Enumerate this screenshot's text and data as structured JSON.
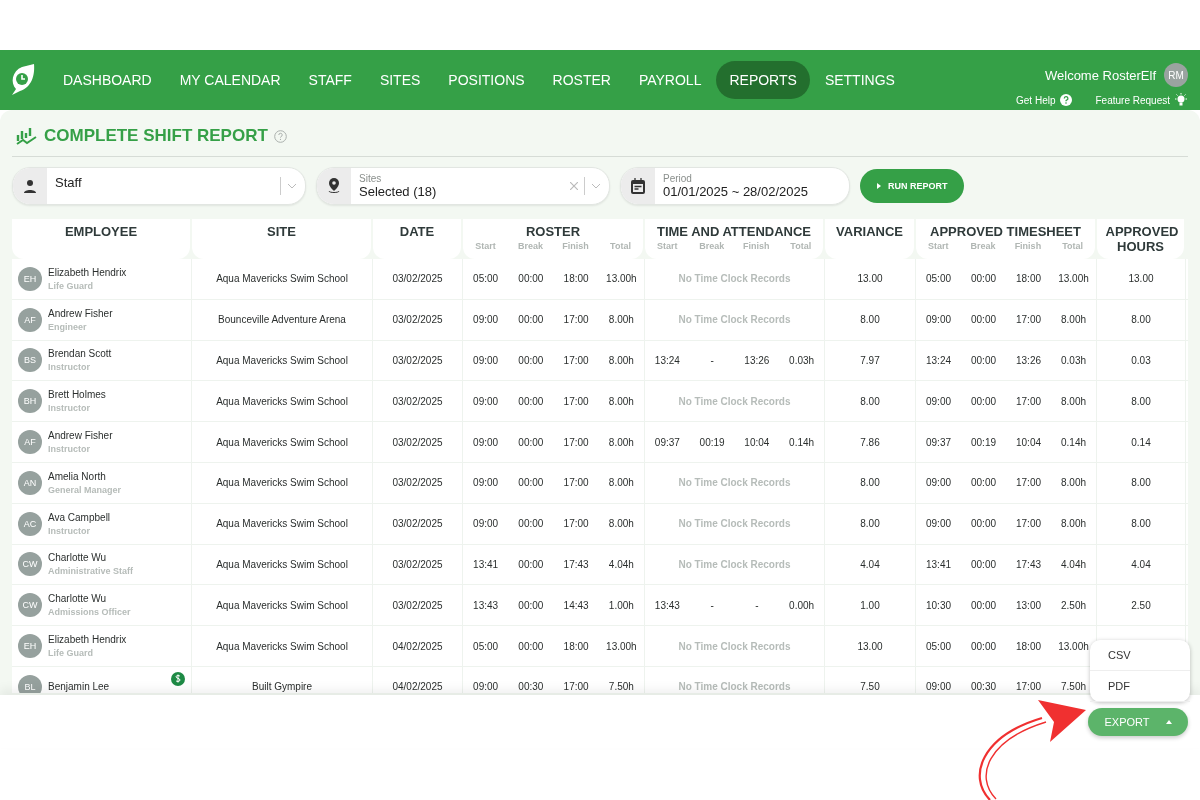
{
  "nav": {
    "items": [
      {
        "label": "DASHBOARD",
        "selected": false
      },
      {
        "label": "MY CALENDAR",
        "selected": false
      },
      {
        "label": "STAFF",
        "selected": false
      },
      {
        "label": "SITES",
        "selected": false
      },
      {
        "label": "POSITIONS",
        "selected": false
      },
      {
        "label": "ROSTER",
        "selected": false
      },
      {
        "label": "PAYROLL",
        "selected": false
      },
      {
        "label": "REPORTS",
        "selected": true
      },
      {
        "label": "SETTINGS",
        "selected": false
      }
    ],
    "welcome": "Welcome RosterElf",
    "avatar": "RM",
    "help": "Get Help",
    "feature": "Feature Request"
  },
  "page_title": "COMPLETE SHIFT REPORT",
  "filters": {
    "staff": {
      "value": "Staff"
    },
    "sites": {
      "label": "Sites",
      "value": "Selected (18)"
    },
    "period": {
      "label": "Period",
      "value": "01/01/2025 ~ 28/02/2025"
    },
    "run": "RUN REPORT"
  },
  "table": {
    "columns": [
      {
        "title": "EMPLOYEE"
      },
      {
        "title": "SITE"
      },
      {
        "title": "DATE"
      },
      {
        "title": "ROSTER",
        "sub": [
          "Start",
          "Break",
          "Finish",
          "Total"
        ]
      },
      {
        "title": "TIME AND ATTENDANCE",
        "sub": [
          "Start",
          "Break",
          "Finish",
          "Total"
        ]
      },
      {
        "title": "VARIANCE"
      },
      {
        "title": "APPROVED TIMESHEET",
        "sub": [
          "Start",
          "Break",
          "Finish",
          "Total"
        ]
      },
      {
        "title": "APPROVED HOURS"
      }
    ],
    "rows": [
      {
        "initials": "EH",
        "name": "Elizabeth Hendrix",
        "role": "Life Guard",
        "site": "Aqua Mavericks Swim School",
        "date": "03/02/2025",
        "roster": [
          "05:00",
          "00:00",
          "18:00",
          "13.00h"
        ],
        "attendance": {
          "kind": "empty",
          "text": "No Time Clock Records"
        },
        "variance": "13.00",
        "approved": [
          "05:00",
          "00:00",
          "18:00",
          "13.00h"
        ],
        "approved_hours": "13.00"
      },
      {
        "initials": "AF",
        "name": "Andrew Fisher",
        "role": "Engineer",
        "site": "Bounceville Adventure Arena",
        "date": "03/02/2025",
        "roster": [
          "09:00",
          "00:00",
          "17:00",
          "8.00h"
        ],
        "attendance": {
          "kind": "empty",
          "text": "No Time Clock Records"
        },
        "variance": "8.00",
        "approved": [
          "09:00",
          "00:00",
          "17:00",
          "8.00h"
        ],
        "approved_hours": "8.00"
      },
      {
        "initials": "BS",
        "name": "Brendan Scott",
        "role": "Instructor",
        "site": "Aqua Mavericks Swim School",
        "date": "03/02/2025",
        "roster": [
          "09:00",
          "00:00",
          "17:00",
          "8.00h"
        ],
        "attendance": {
          "kind": "times",
          "values": [
            "13:24",
            "-",
            "13:26",
            "0.03h"
          ]
        },
        "variance": "7.97",
        "approved": [
          "13:24",
          "00:00",
          "13:26",
          "0.03h"
        ],
        "approved_hours": "0.03"
      },
      {
        "initials": "BH",
        "name": "Brett Holmes",
        "role": "Instructor",
        "site": "Aqua Mavericks Swim School",
        "date": "03/02/2025",
        "roster": [
          "09:00",
          "00:00",
          "17:00",
          "8.00h"
        ],
        "attendance": {
          "kind": "empty",
          "text": "No Time Clock Records"
        },
        "variance": "8.00",
        "approved": [
          "09:00",
          "00:00",
          "17:00",
          "8.00h"
        ],
        "approved_hours": "8.00"
      },
      {
        "initials": "AF",
        "name": "Andrew Fisher",
        "role": "Instructor",
        "site": "Aqua Mavericks Swim School",
        "date": "03/02/2025",
        "roster": [
          "09:00",
          "00:00",
          "17:00",
          "8.00h"
        ],
        "attendance": {
          "kind": "times",
          "values": [
            "09:37",
            "00:19",
            "10:04",
            "0.14h"
          ]
        },
        "variance": "7.86",
        "approved": [
          "09:37",
          "00:19",
          "10:04",
          "0.14h"
        ],
        "approved_hours": "0.14"
      },
      {
        "initials": "AN",
        "name": "Amelia North",
        "role": "General Manager",
        "site": "Aqua Mavericks Swim School",
        "date": "03/02/2025",
        "roster": [
          "09:00",
          "00:00",
          "17:00",
          "8.00h"
        ],
        "attendance": {
          "kind": "empty",
          "text": "No Time Clock Records"
        },
        "variance": "8.00",
        "approved": [
          "09:00",
          "00:00",
          "17:00",
          "8.00h"
        ],
        "approved_hours": "8.00"
      },
      {
        "initials": "AC",
        "name": "Ava Campbell",
        "role": "Instructor",
        "site": "Aqua Mavericks Swim School",
        "date": "03/02/2025",
        "roster": [
          "09:00",
          "00:00",
          "17:00",
          "8.00h"
        ],
        "attendance": {
          "kind": "empty",
          "text": "No Time Clock Records"
        },
        "variance": "8.00",
        "approved": [
          "09:00",
          "00:00",
          "17:00",
          "8.00h"
        ],
        "approved_hours": "8.00"
      },
      {
        "initials": "CW",
        "name": "Charlotte Wu",
        "role": "Administrative Staff",
        "site": "Aqua Mavericks Swim School",
        "date": "03/02/2025",
        "roster": [
          "13:41",
          "00:00",
          "17:43",
          "4.04h"
        ],
        "attendance": {
          "kind": "empty",
          "text": "No Time Clock Records"
        },
        "variance": "4.04",
        "approved": [
          "13:41",
          "00:00",
          "17:43",
          "4.04h"
        ],
        "approved_hours": "4.04"
      },
      {
        "initials": "CW",
        "name": "Charlotte Wu",
        "role": "Admissions Officer",
        "site": "Aqua Mavericks Swim School",
        "date": "03/02/2025",
        "roster": [
          "13:43",
          "00:00",
          "14:43",
          "1.00h"
        ],
        "attendance": {
          "kind": "times",
          "values": [
            "13:43",
            "-",
            "-",
            "0.00h"
          ]
        },
        "variance": "1.00",
        "approved": [
          "10:30",
          "00:00",
          "13:00",
          "2.50h"
        ],
        "approved_hours": "2.50"
      },
      {
        "initials": "EH",
        "name": "Elizabeth Hendrix",
        "role": "Life Guard",
        "site": "Aqua Mavericks Swim School",
        "date": "04/02/2025",
        "roster": [
          "05:00",
          "00:00",
          "18:00",
          "13.00h"
        ],
        "attendance": {
          "kind": "empty",
          "text": "No Time Clock Records"
        },
        "variance": "13.00",
        "approved": [
          "05:00",
          "00:00",
          "18:00",
          "13.00h"
        ]
      },
      {
        "initials": "BL",
        "name": "Benjamin Lee",
        "pay_flag": true,
        "site": "Built Gympire",
        "date": "04/02/2025",
        "roster": [
          "09:00",
          "00:30",
          "17:00",
          "7.50h"
        ],
        "attendance": {
          "kind": "empty",
          "text": "No Time Clock Records"
        },
        "variance": "7.50",
        "approved": [
          "09:00",
          "00:30",
          "17:00",
          "7.50h"
        ]
      }
    ]
  },
  "export": {
    "menu": [
      "CSV",
      "PDF"
    ],
    "button": "EXPORT"
  }
}
